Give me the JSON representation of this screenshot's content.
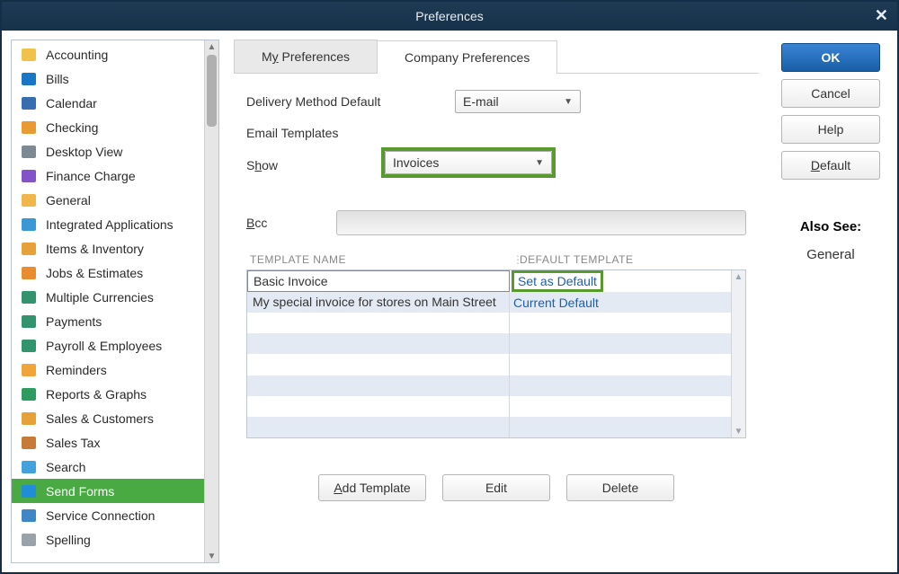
{
  "window_title": "Preferences",
  "sidebar": {
    "items": [
      {
        "label": "Accounting",
        "icon": "#f0c24b"
      },
      {
        "label": "Bills",
        "icon": "#1976c5"
      },
      {
        "label": "Calendar",
        "icon": "#3a6db0"
      },
      {
        "label": "Checking",
        "icon": "#e79b32"
      },
      {
        "label": "Desktop View",
        "icon": "#7d8a94"
      },
      {
        "label": "Finance Charge",
        "icon": "#8254c7"
      },
      {
        "label": "General",
        "icon": "#f0b54b"
      },
      {
        "label": "Integrated Applications",
        "icon": "#3b98d6"
      },
      {
        "label": "Items & Inventory",
        "icon": "#e7a13a"
      },
      {
        "label": "Jobs & Estimates",
        "icon": "#e98b2f"
      },
      {
        "label": "Multiple Currencies",
        "icon": "#32946f"
      },
      {
        "label": "Payments",
        "icon": "#32946f"
      },
      {
        "label": "Payroll & Employees",
        "icon": "#32946f"
      },
      {
        "label": "Reminders",
        "icon": "#f0a43a"
      },
      {
        "label": "Reports & Graphs",
        "icon": "#2f9b61"
      },
      {
        "label": "Sales & Customers",
        "icon": "#e7a13a"
      },
      {
        "label": "Sales Tax",
        "icon": "#c77b38"
      },
      {
        "label": "Search",
        "icon": "#42a2de"
      },
      {
        "label": "Send Forms",
        "icon": "#1f8ed6"
      },
      {
        "label": "Service Connection",
        "icon": "#3f86c5"
      },
      {
        "label": "Spelling",
        "icon": "#9aa3a9"
      }
    ],
    "selected_index": 18
  },
  "tabs": {
    "my": {
      "text_pre": "M",
      "text_u": "y",
      "text_post": " Preferences"
    },
    "company": {
      "text": "Company Preferences"
    },
    "active": "company"
  },
  "form": {
    "delivery_method_label": "Delivery Method Default",
    "delivery_method_value": "E-mail",
    "email_templates_label": "Email Templates",
    "show_label_pre": "S",
    "show_label_u": "h",
    "show_label_post": "ow",
    "show_value": "Invoices",
    "bcc_label_u": "B",
    "bcc_label_post": "cc",
    "bcc_value": "",
    "table_hdr_name": "TEMPLATE NAME",
    "table_hdr_default": "DEFAULT TEMPLATE",
    "templates": [
      {
        "name": "Basic Invoice",
        "default_label": "Set as Default"
      },
      {
        "name": "My special invoice for stores on Main Street",
        "default_label": "Current Default"
      }
    ]
  },
  "buttons": {
    "add_u": "A",
    "add_post": "dd Template",
    "edit": "Edit",
    "delete": "Delete",
    "ok": "OK",
    "cancel": "Cancel",
    "help": "Help",
    "default_u": "D",
    "default_post": "efault"
  },
  "also_see": {
    "header": "Also See:",
    "link": "General"
  }
}
